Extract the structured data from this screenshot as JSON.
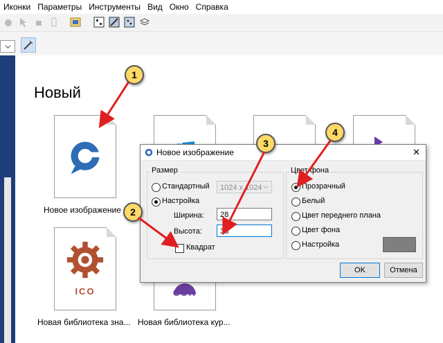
{
  "menu": [
    "Иконки",
    "Параметры",
    "Инструменты",
    "Вид",
    "Окно",
    "Справка"
  ],
  "heading": "Новый",
  "cards": [
    {
      "caption": "Новое изображение"
    },
    {
      "caption": ""
    },
    {
      "caption": ""
    },
    {
      "caption": ""
    },
    {
      "caption": "Новая библиотека зна...",
      "badge": "ICO"
    },
    {
      "caption": "Новая библиотека кур...",
      "badge": "CUR"
    }
  ],
  "dialog": {
    "title": "Новое изображение",
    "size_group": "Размер",
    "standard_label": "Стандартный",
    "standard_value": "1024 x 1024",
    "custom_label": "Настройка",
    "width_label": "Ширина:",
    "width_value": "28",
    "height_label": "Высота:",
    "height_value": "38",
    "square_label": "Квадрат",
    "bg_group": "Цвет фона",
    "bg_options": [
      "Прозрачный",
      "Белый",
      "Цвет переднего плана",
      "Цвет фона",
      "Настройка"
    ],
    "ok": "OK",
    "cancel": "Отмена",
    "close": "✕"
  },
  "callouts": [
    "1",
    "2",
    "3",
    "4"
  ],
  "colors": {
    "sidebar": "#1f3d7a",
    "callout": "#ffd966",
    "arrow": "#e02020",
    "swatch": "#7f7f7f"
  }
}
